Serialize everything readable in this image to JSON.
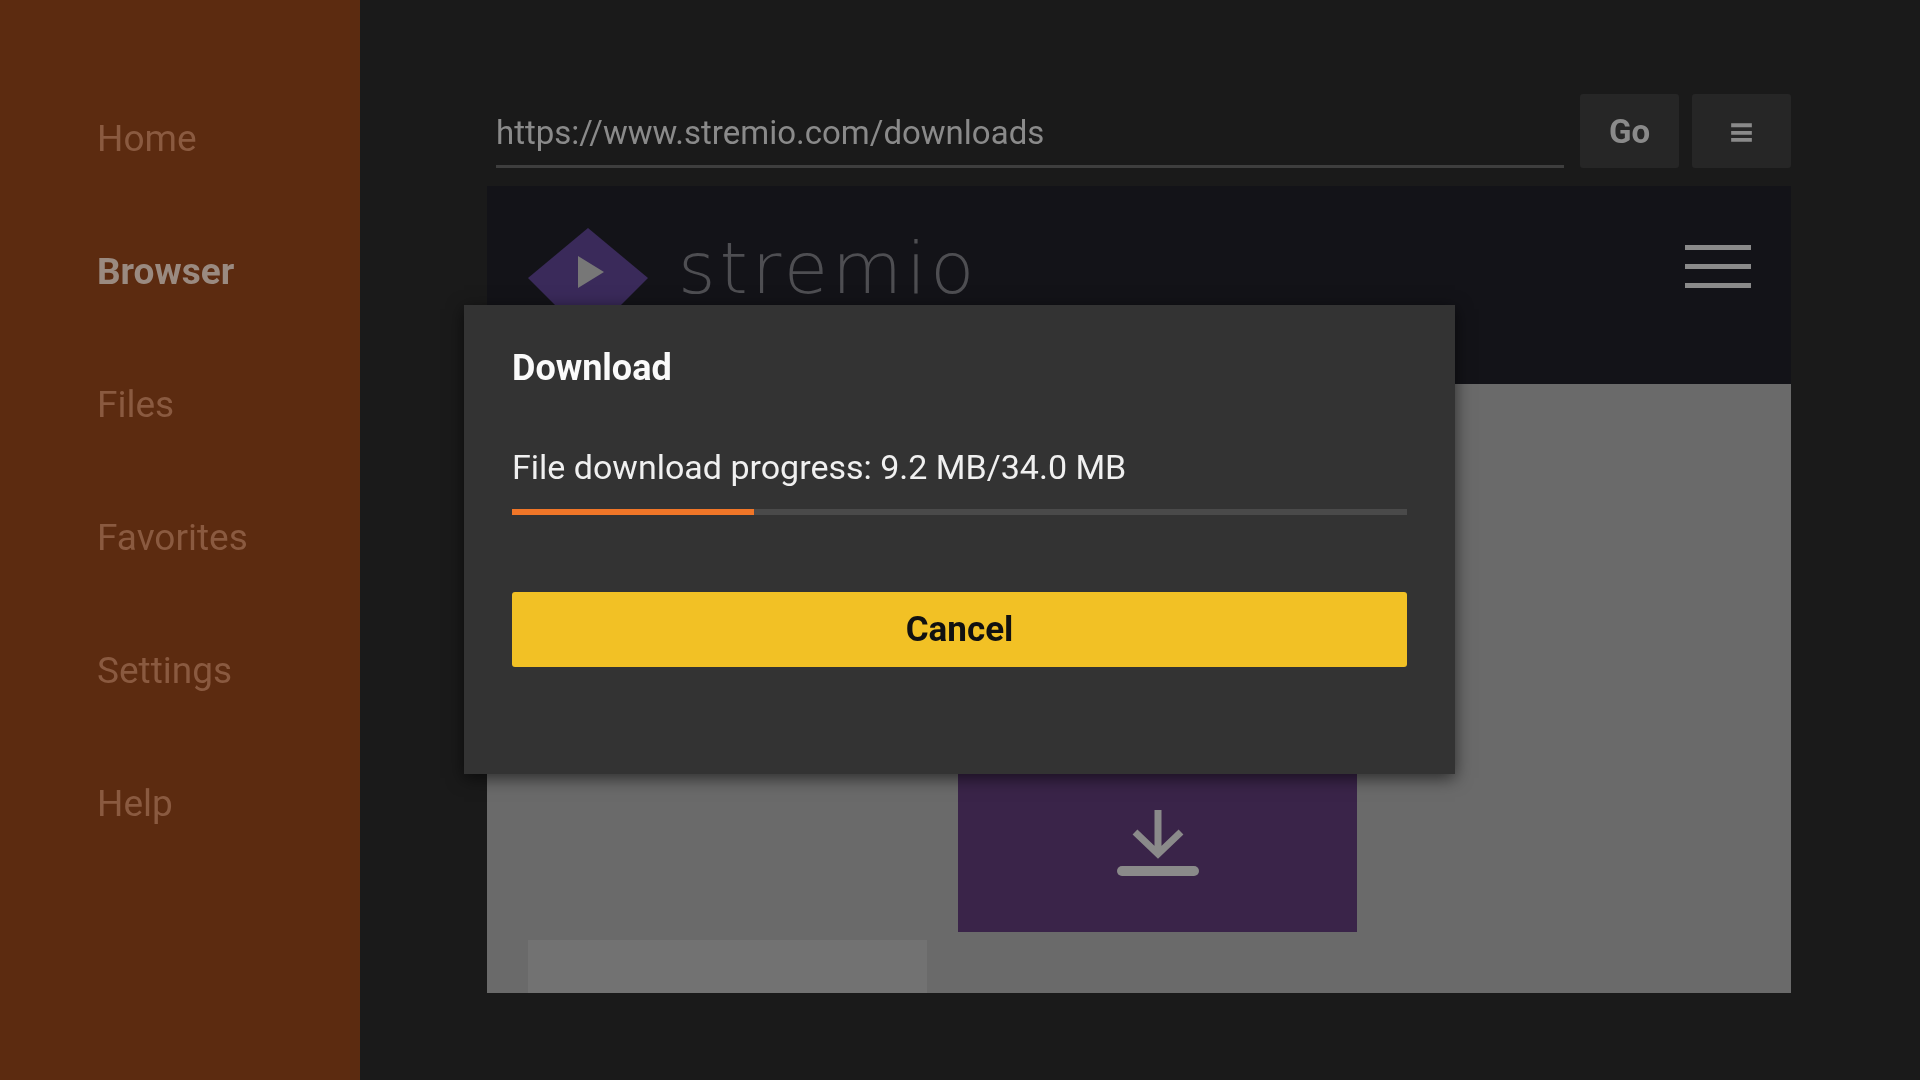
{
  "sidebar": {
    "items": [
      {
        "label": "Home",
        "selected": false
      },
      {
        "label": "Browser",
        "selected": true
      },
      {
        "label": "Files",
        "selected": false
      },
      {
        "label": "Favorites",
        "selected": false
      },
      {
        "label": "Settings",
        "selected": false
      },
      {
        "label": "Help",
        "selected": false
      }
    ]
  },
  "address_bar": {
    "value": "https://www.stremio.com/downloads",
    "go_button": "Go",
    "menu_button": "≡"
  },
  "web_page": {
    "logo_text": "stremio"
  },
  "dialog": {
    "title": "Download",
    "message": "File download progress: 9.2 MB/34.0 MB",
    "progress": {
      "level": 0.27
    },
    "button": "Cancel"
  }
}
